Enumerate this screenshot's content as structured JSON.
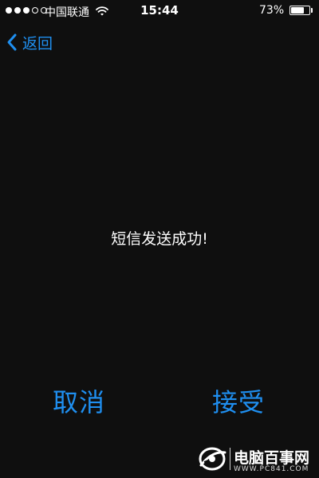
{
  "status_bar": {
    "signal_bars_filled": 3,
    "signal_bars_total": 5,
    "carrier": "中国联通",
    "wifi_icon": "wifi-icon",
    "time": "15:44",
    "battery_percent_label": "73%",
    "battery_level": 0.73
  },
  "nav": {
    "back_icon": "chevron-left-icon",
    "back_label": "返回"
  },
  "message": "短信发送成功!",
  "actions": {
    "cancel_label": "取消",
    "accept_label": "接受"
  },
  "watermark": {
    "title": "电脑百事网",
    "url": "WWW.PC841.COM"
  },
  "colors": {
    "background": "#0f0f0f",
    "accent": "#1f8ff0",
    "text": "#ffffff"
  }
}
